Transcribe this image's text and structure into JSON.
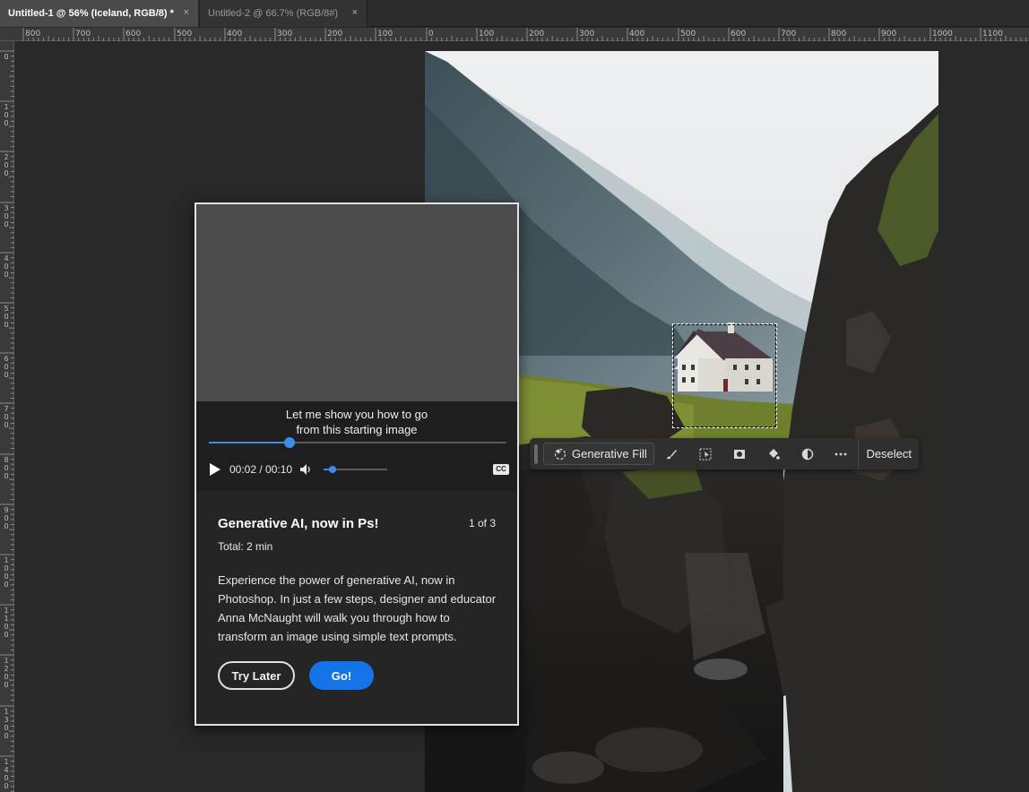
{
  "tabs": [
    {
      "label": "Untitled-1 @ 56% (Iceland, RGB/8) *",
      "close": "×",
      "active": true
    },
    {
      "label": "Untitled-2 @ 66.7% (RGB/8#)",
      "close": "×",
      "active": false
    }
  ],
  "ruler_top": {
    "labels": [
      "800",
      "700",
      "600",
      "500",
      "400",
      "300",
      "200",
      "100",
      "0",
      "100",
      "200",
      "300",
      "400",
      "500",
      "600",
      "700",
      "800",
      "900",
      "1000",
      "1100"
    ]
  },
  "ruler_left": {
    "labels": [
      "0",
      "100",
      "200",
      "300",
      "400",
      "500",
      "600",
      "700",
      "800",
      "900",
      "1000",
      "1100",
      "1200",
      "1300",
      "1400"
    ]
  },
  "canvas": {
    "layer_name": "Iceland"
  },
  "taskbar": {
    "generative_fill_label": "Generative Fill",
    "tools": [
      "brush-refine-icon",
      "select-subject-icon",
      "mask-icon",
      "fill-bucket-icon",
      "adjustment-icon",
      "more-options-icon"
    ],
    "deselect_label": "Deselect"
  },
  "learn_panel": {
    "caption_line1": "Let me show you how to go",
    "caption_line2": "from this starting image",
    "progress": 0.27,
    "time": "00:02 / 00:10",
    "volume": 0.14,
    "cc_label": "CC",
    "title": "Generative AI, now in Ps!",
    "step": "1 of 3",
    "total": "Total: 2 min",
    "description": "Experience the power of generative AI, now in Photoshop. In just a few steps, designer and educator Anna McNaught will walk you through how to transform an image using simple text prompts.",
    "try_later_label": "Try Later",
    "go_label": "Go!"
  },
  "colors": {
    "accent": "#1473e6",
    "slider": "#3b8de8",
    "panel_bg": "#252525",
    "app_bg": "#282828"
  }
}
